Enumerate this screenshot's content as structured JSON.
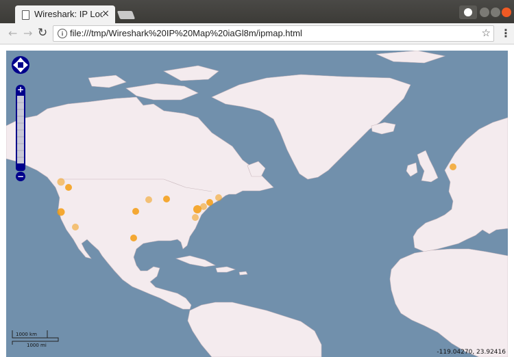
{
  "browser": {
    "tab_title": "Wireshark: IP Locati",
    "tab_close": "×",
    "url": "file:///tmp/Wireshark%20IP%20Map%20iaGl8m/ipmap.html",
    "back_glyph": "←",
    "forward_glyph": "→",
    "reload_glyph": "↻",
    "star_glyph": "☆",
    "menu_glyph": "⋮",
    "info_glyph": "i"
  },
  "map": {
    "zoom_in": "+",
    "zoom_out": "−",
    "scale_km": "1000 km",
    "scale_mi": "1000 mi",
    "coordinates": "-119.04270, 23.92416",
    "colors": {
      "ocean": "#7190ac",
      "land": "#f4ebee",
      "marker": "#f39c12",
      "control": "#00008b"
    }
  }
}
